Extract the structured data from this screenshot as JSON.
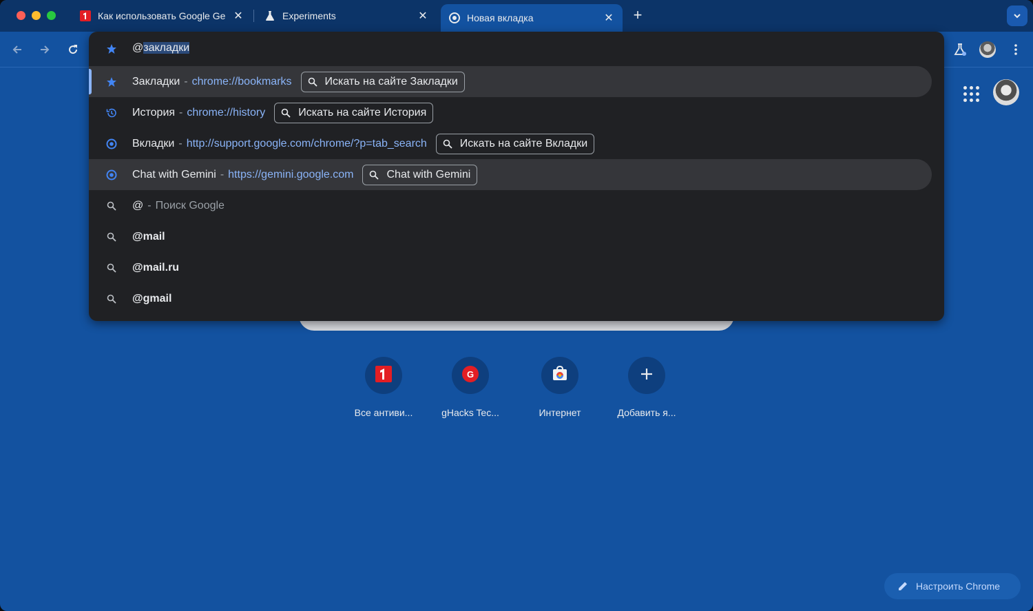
{
  "tabs": [
    {
      "title": "Как использовать Google Ge",
      "favicon": "1-red-logo-icon"
    },
    {
      "title": "Experiments",
      "favicon": "beaker-icon"
    },
    {
      "title": "Новая вкладка",
      "favicon": "chrome-icon",
      "active": true
    }
  ],
  "omnibox": {
    "typed_prefix": "@",
    "typed_selected": "закладки",
    "suggestions": [
      {
        "title": "Закладки",
        "separator": "-",
        "url": "chrome://bookmarks",
        "chip": "Искать на сайте Закладки",
        "icon": "star-icon"
      },
      {
        "title": "История",
        "separator": "-",
        "url": "chrome://history",
        "chip": "Искать на сайте История",
        "icon": "history-icon"
      },
      {
        "title": "Вкладки",
        "separator": "-",
        "url": "http://support.google.com/chrome/?p=tab_search",
        "chip": "Искать на сайте Вкладки",
        "icon": "chrome-icon"
      },
      {
        "title": "Chat with Gemini",
        "separator": "-",
        "url": "https://gemini.google.com",
        "chip": "Chat with Gemini",
        "icon": "chrome-icon"
      },
      {
        "title": "@",
        "separator": "-",
        "suffix": "Поиск Google",
        "icon": "search-icon"
      },
      {
        "title": "@mail",
        "icon": "search-icon"
      },
      {
        "title": "@mail.ru",
        "icon": "search-icon"
      },
      {
        "title": "@gmail",
        "icon": "search-icon"
      }
    ]
  },
  "shortcuts": [
    {
      "label": "Все антиви...",
      "icon": "1-red-logo-icon"
    },
    {
      "label": "gHacks Tec...",
      "icon": "ghacks-icon"
    },
    {
      "label": "Интернет",
      "icon": "chrome-web-store-icon"
    },
    {
      "label": "Добавить я...",
      "icon": "plus-icon"
    }
  ],
  "customize_label": "Настроить Chrome",
  "colors": {
    "page_bg": "#1352a0",
    "tabstrip_bg": "#0c3468",
    "omnibox_bg": "#202124",
    "link": "#8ab4f8",
    "accent_blue": "#4285f4"
  }
}
